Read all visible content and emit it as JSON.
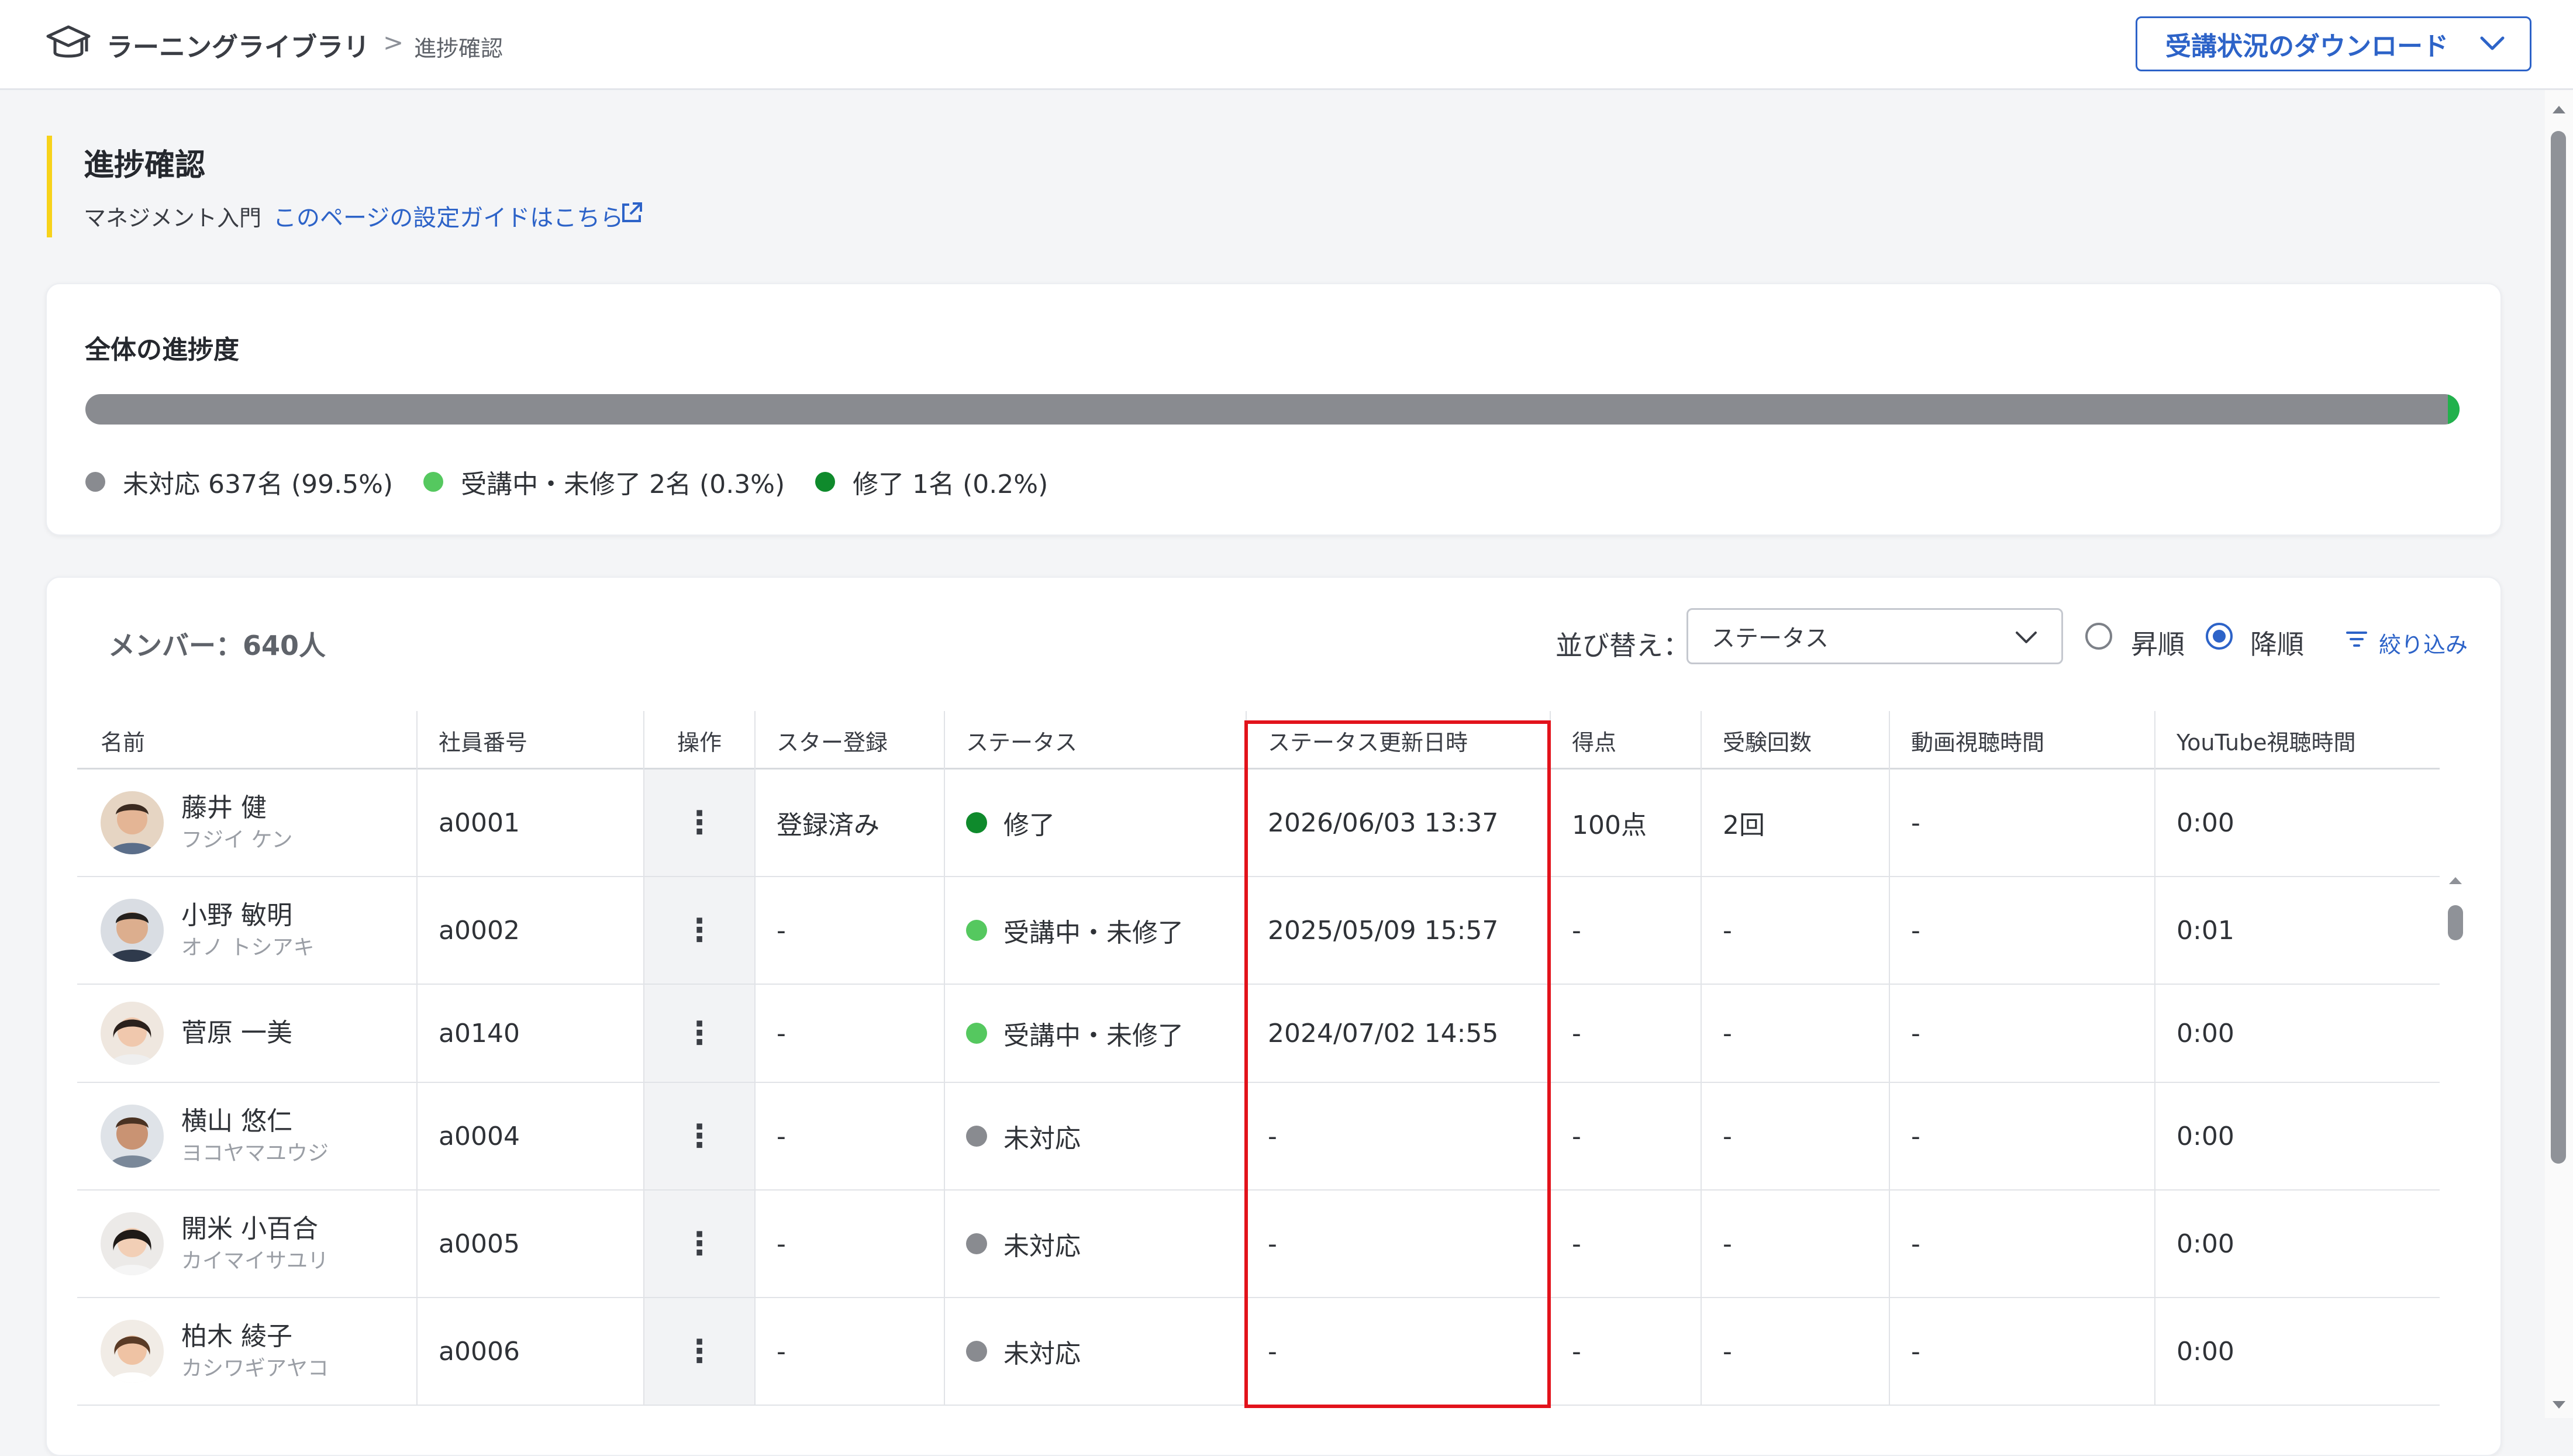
{
  "header": {
    "app_title": "ラーニングライブラリ",
    "separator": ">",
    "current_page": "進捗確認",
    "download_button": "受講状況のダウンロード"
  },
  "page": {
    "title": "進捗確認",
    "course_name": "マネジメント入門",
    "guide_link": "このページの設定ガイドはこちら"
  },
  "progress": {
    "title": "全体の進捗度",
    "completed_fraction": 0.005,
    "legend": [
      {
        "label": "未対応 637名 (99.5%)",
        "color": "#898b90"
      },
      {
        "label": "受講中・未修了 2名 (0.3%)",
        "color": "#55c85f"
      },
      {
        "label": "修了 1名 (0.2%)",
        "color": "#0f8a2c"
      }
    ]
  },
  "members": {
    "count_label": "メンバー：640人",
    "sort_label": "並び替え：",
    "sort_value": "ステータス",
    "order_asc": "昇順",
    "order_desc": "降順",
    "order_selected": "降順",
    "filter_label": "絞り込み",
    "columns": [
      "名前",
      "社員番号",
      "操作",
      "スター登録",
      "ステータス",
      "ステータス更新日時",
      "得点",
      "受験回数",
      "動画視聴時間",
      "YouTube視聴時間"
    ],
    "rows": [
      {
        "name": "藤井 健",
        "kana": "フジイ ケン",
        "emp_id": "a0001",
        "star": "登録済み",
        "status": "修了",
        "status_color": "#0f8a2c",
        "updated": "2026/06/03 13:37",
        "score": "100点",
        "attempts": "2回",
        "video_time": "-",
        "youtube_time": "0:00"
      },
      {
        "name": "小野 敏明",
        "kana": "オノ トシアキ",
        "emp_id": "a0002",
        "star": "-",
        "status": "受講中・未修了",
        "status_color": "#55c85f",
        "updated": "2025/05/09 15:57",
        "score": "-",
        "attempts": "-",
        "video_time": "-",
        "youtube_time": "0:01"
      },
      {
        "name": "菅原 一美",
        "kana": "",
        "emp_id": "a0140",
        "star": "-",
        "status": "受講中・未修了",
        "status_color": "#55c85f",
        "updated": "2024/07/02 14:55",
        "score": "-",
        "attempts": "-",
        "video_time": "-",
        "youtube_time": "0:00"
      },
      {
        "name": "横山 悠仁",
        "kana": "ヨコヤマユウジ",
        "emp_id": "a0004",
        "star": "-",
        "status": "未対応",
        "status_color": "#898b90",
        "updated": "-",
        "score": "-",
        "attempts": "-",
        "video_time": "-",
        "youtube_time": "0:00"
      },
      {
        "name": "開米 小百合",
        "kana": "カイマイサユリ",
        "emp_id": "a0005",
        "star": "-",
        "status": "未対応",
        "status_color": "#898b90",
        "updated": "-",
        "score": "-",
        "attempts": "-",
        "video_time": "-",
        "youtube_time": "0:00"
      },
      {
        "name": "柏木 綾子",
        "kana": "カシワギアヤコ",
        "emp_id": "a0006",
        "star": "-",
        "status": "未対応",
        "status_color": "#898b90",
        "updated": "-",
        "score": "-",
        "attempts": "-",
        "video_time": "-",
        "youtube_time": "0:00"
      }
    ]
  }
}
